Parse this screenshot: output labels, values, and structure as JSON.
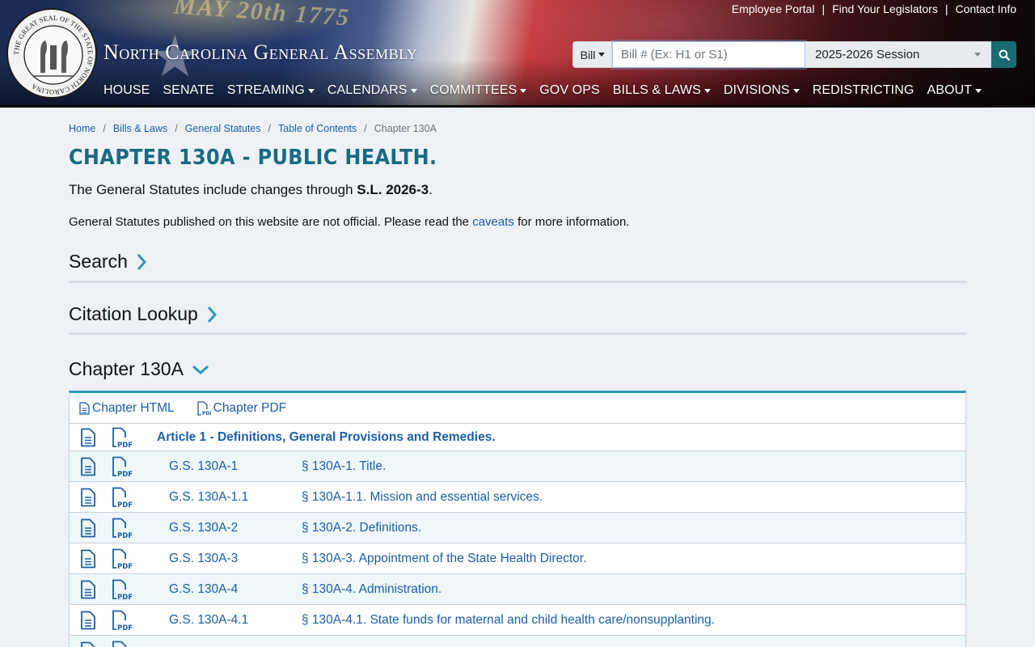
{
  "header": {
    "site_title": "North Carolina General Assembly",
    "seal_text": "THE GREAT SEAL OF THE STATE OF NORTH CAROLINA",
    "banner_motto": "MAY 20th 1775",
    "utility_links": [
      {
        "label": "Employee Portal"
      },
      {
        "label": "Find Your Legislators"
      },
      {
        "label": "Contact Info"
      }
    ],
    "search": {
      "type_label": "Bill",
      "placeholder": "Bill # (Ex: H1 or S1)",
      "session": "2025-2026 Session"
    },
    "nav": [
      {
        "label": "HOUSE",
        "dropdown": false
      },
      {
        "label": "SENATE",
        "dropdown": false
      },
      {
        "label": "STREAMING",
        "dropdown": true
      },
      {
        "label": "CALENDARS",
        "dropdown": true
      },
      {
        "label": "COMMITTEES",
        "dropdown": true
      },
      {
        "label": "GOV OPS",
        "dropdown": false
      },
      {
        "label": "BILLS & LAWS",
        "dropdown": true
      },
      {
        "label": "DIVISIONS",
        "dropdown": true
      },
      {
        "label": "REDISTRICTING",
        "dropdown": false
      },
      {
        "label": "ABOUT",
        "dropdown": true
      }
    ]
  },
  "breadcrumb": {
    "items": [
      "Home",
      "Bills & Laws",
      "General Statutes",
      "Table of Contents"
    ],
    "current": "Chapter 130A"
  },
  "page": {
    "title": "CHAPTER 130A - PUBLIC HEALTH.",
    "changes_prefix": "The General Statutes include changes through ",
    "changes_law": "S.L. 2026-3",
    "changes_suffix": ".",
    "disclaimer_prefix": "General Statutes published on this website are not official. Please read the ",
    "disclaimer_link": "caveats",
    "disclaimer_suffix": " for more information."
  },
  "sections": {
    "search": "Search",
    "citation": "Citation Lookup",
    "chapter": "Chapter 130A"
  },
  "toolbar": {
    "html_label": "Chapter HTML",
    "pdf_label": "Chapter PDF"
  },
  "table": {
    "article": "Article 1 - Definitions, General Provisions and Remedies.",
    "rows": [
      {
        "gs": "G.S. 130A-1",
        "title": "§ 130A-1. Title."
      },
      {
        "gs": "G.S. 130A-1.1",
        "title": "§ 130A-1.1. Mission and essential services."
      },
      {
        "gs": "G.S. 130A-2",
        "title": "§ 130A-2. Definitions."
      },
      {
        "gs": "G.S. 130A-3",
        "title": "§ 130A-3. Appointment of the State Health Director."
      },
      {
        "gs": "G.S. 130A-4",
        "title": "§ 130A-4. Administration."
      },
      {
        "gs": "G.S. 130A-4.1",
        "title": "§ 130A-4.1. State funds for maternal and child health care/nonsupplanting."
      }
    ]
  },
  "colors": {
    "link": "#1b5fa8",
    "title": "#176b84",
    "accent": "#2a9bb6",
    "search_button": "#176b73"
  }
}
